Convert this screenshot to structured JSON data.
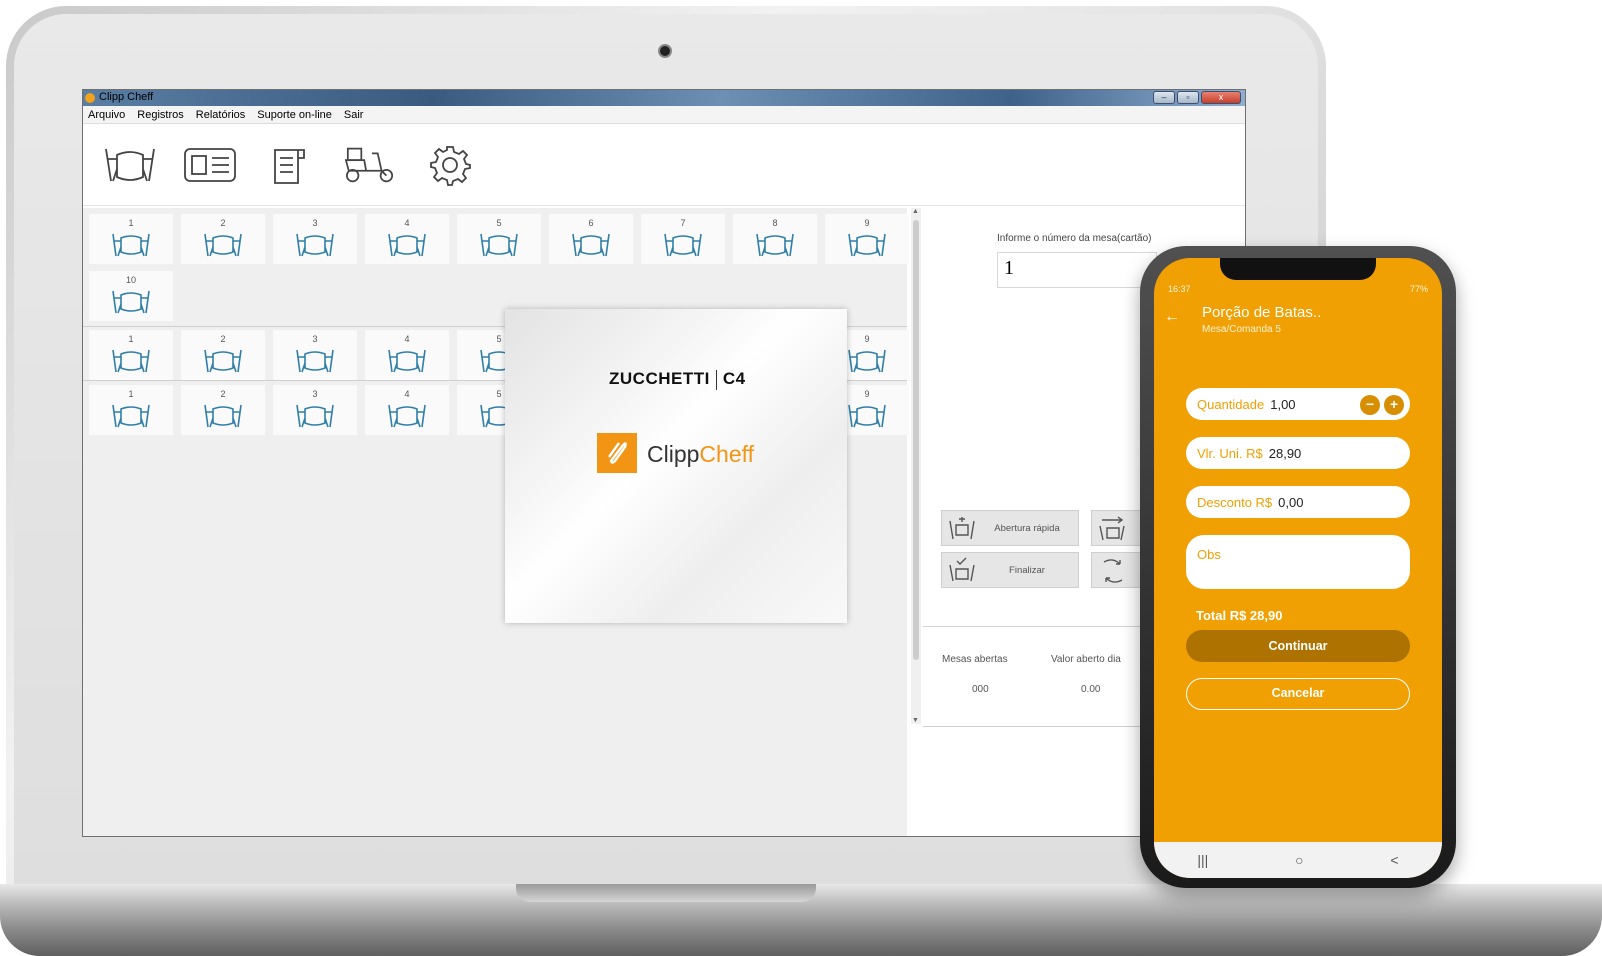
{
  "window": {
    "title": "Clipp Cheff",
    "min": "–",
    "max": "▫",
    "close": "x"
  },
  "menu": [
    "Arquivo",
    "Registros",
    "Relatórios",
    "Suporte on-line",
    "Sair"
  ],
  "toolbar": [
    {
      "icon": "table-icon"
    },
    {
      "icon": "card-icon"
    },
    {
      "icon": "receipt-icon"
    },
    {
      "icon": "delivery-scooter-icon"
    },
    {
      "icon": "settings-gear-icon"
    }
  ],
  "table_groups": [
    {
      "row1": [
        "1",
        "2",
        "3",
        "4",
        "5",
        "6",
        "7",
        "8",
        "9"
      ],
      "row2": [
        "10"
      ]
    },
    {
      "row1": [
        "1",
        "2",
        "3",
        "4",
        "5",
        "",
        "",
        "",
        "9"
      ]
    },
    {
      "row1": [
        "1",
        "2",
        "3",
        "4",
        "5",
        "",
        "",
        "",
        "9"
      ]
    }
  ],
  "side": {
    "label": "Informe o número da mesa(cartão)",
    "input_value": "1",
    "btn_quick": "Abertura rápida",
    "btn_finish": "Finalizar",
    "stat_open_label": "Mesas abertas",
    "stat_value_label": "Valor aberto dia",
    "stat_open": "000",
    "stat_value": "0.00"
  },
  "splash": {
    "brand": "ZUCCHETTI",
    "brand_code": "C4",
    "name_a": "Clipp",
    "name_b": "Cheff"
  },
  "phone": {
    "time": "16:37",
    "battery": "77%",
    "title": "Porção de Batas..",
    "subtitle": "Mesa/Comanda 5",
    "qty_label": "Quantidade",
    "qty_value": "1,00",
    "unit_label": "Vlr. Uni. R$",
    "unit_value": "28,90",
    "disc_label": "Desconto R$",
    "disc_value": "0,00",
    "obs_label": "Obs",
    "total": "Total R$ 28,90",
    "continue": "Continuar",
    "cancel": "Cancelar",
    "nav": [
      "|||",
      "○",
      "<"
    ]
  },
  "colors": {
    "accent": "#f0a003",
    "table_icon": "#2f7fa8",
    "brand_orange": "#f39514"
  }
}
